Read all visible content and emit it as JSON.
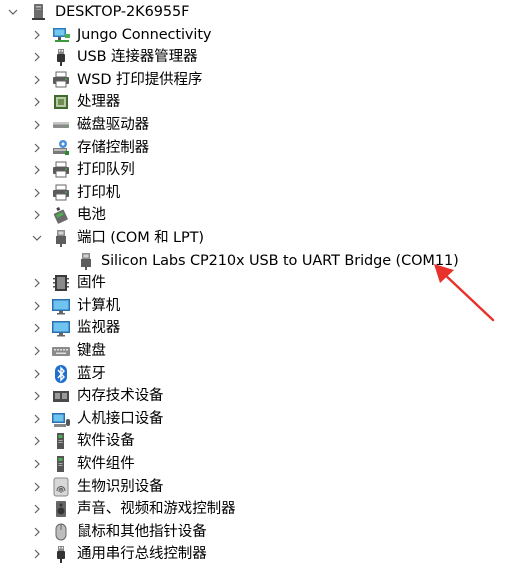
{
  "root": {
    "label": "DESKTOP-2K6955F",
    "icon": "computer-icon",
    "expanded": true
  },
  "items": [
    {
      "label": "Jungo Connectivity",
      "icon": "network-icon",
      "expanded": false
    },
    {
      "label": "USB 连接器管理器",
      "icon": "usb-icon",
      "expanded": false
    },
    {
      "label": "WSD 打印提供程序",
      "icon": "printer-icon",
      "expanded": false
    },
    {
      "label": "处理器",
      "icon": "chip-icon",
      "expanded": false
    },
    {
      "label": "磁盘驱动器",
      "icon": "disk-icon",
      "expanded": false
    },
    {
      "label": "存储控制器",
      "icon": "storage-controller-icon",
      "expanded": false
    },
    {
      "label": "打印队列",
      "icon": "printer-icon",
      "expanded": false
    },
    {
      "label": "打印机",
      "icon": "printer-icon",
      "expanded": false
    },
    {
      "label": "电池",
      "icon": "battery-icon",
      "expanded": false
    },
    {
      "label": "端口 (COM 和 LPT)",
      "icon": "port-icon",
      "expanded": true,
      "children": [
        {
          "label": "Silicon Labs CP210x USB to UART Bridge (COM11)",
          "icon": "port-icon"
        }
      ]
    },
    {
      "label": "固件",
      "icon": "firmware-icon",
      "expanded": false
    },
    {
      "label": "计算机",
      "icon": "monitor-icon",
      "expanded": false
    },
    {
      "label": "监视器",
      "icon": "monitor-icon",
      "expanded": false
    },
    {
      "label": "键盘",
      "icon": "keyboard-icon",
      "expanded": false
    },
    {
      "label": "蓝牙",
      "icon": "bluetooth-icon",
      "expanded": false
    },
    {
      "label": "内存技术设备",
      "icon": "memory-icon",
      "expanded": false
    },
    {
      "label": "人机接口设备",
      "icon": "hid-icon",
      "expanded": false
    },
    {
      "label": "软件设备",
      "icon": "software-device-icon",
      "expanded": false
    },
    {
      "label": "软件组件",
      "icon": "software-component-icon",
      "expanded": false
    },
    {
      "label": "生物识别设备",
      "icon": "fingerprint-icon",
      "expanded": false
    },
    {
      "label": "声音、视频和游戏控制器",
      "icon": "speaker-icon",
      "expanded": false
    },
    {
      "label": "鼠标和其他指针设备",
      "icon": "mouse-icon",
      "expanded": false
    },
    {
      "label": "通用串行总线控制器",
      "icon": "usb-icon",
      "expanded": false
    }
  ],
  "annotation": {
    "type": "arrow",
    "color": "#e8312a"
  }
}
